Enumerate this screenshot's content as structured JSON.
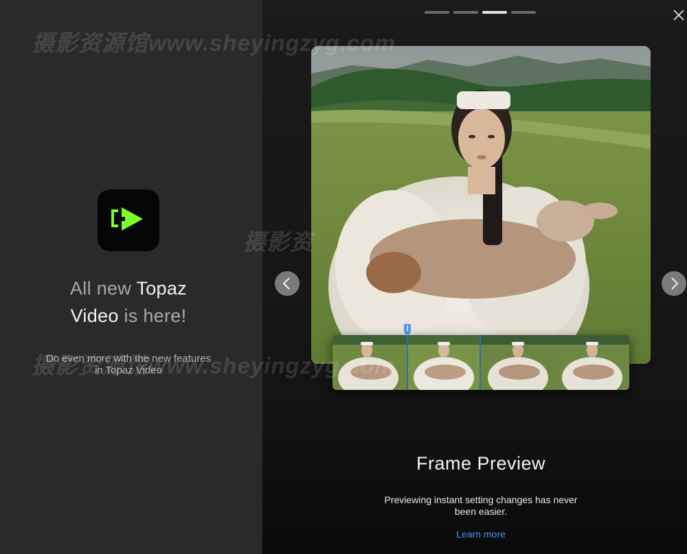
{
  "intro": {
    "headline_part1": "All new ",
    "headline_brand": "Topaz",
    "headline_part2": "Video",
    "headline_part3": " is here!",
    "subtext": "Do even more with the new features in Topaz Video"
  },
  "onboarding": {
    "steps_total": 4,
    "active_step": 3,
    "feature_title": "Frame Preview",
    "feature_description": "Previewing instant setting changes has never been easier.",
    "learn_more_label": "Learn more"
  },
  "watermarks": {
    "top": "摄影资源馆www.sheyingzyg.com",
    "middle": "摄影资",
    "lower": "摄影资源馆www.sheyingzyg.com"
  },
  "colors": {
    "accent_green": "#7cff2b",
    "link_blue": "#4f8ff0",
    "left_panel_bg": "#2a2a2a",
    "right_panel_bg": "#1b1b1b"
  },
  "icons": {
    "app_logo": "topaz-video-logo-icon",
    "close": "close-icon",
    "prev": "chevron-left-icon",
    "next": "chevron-right-icon",
    "playhead": "playhead-marker-icon"
  }
}
